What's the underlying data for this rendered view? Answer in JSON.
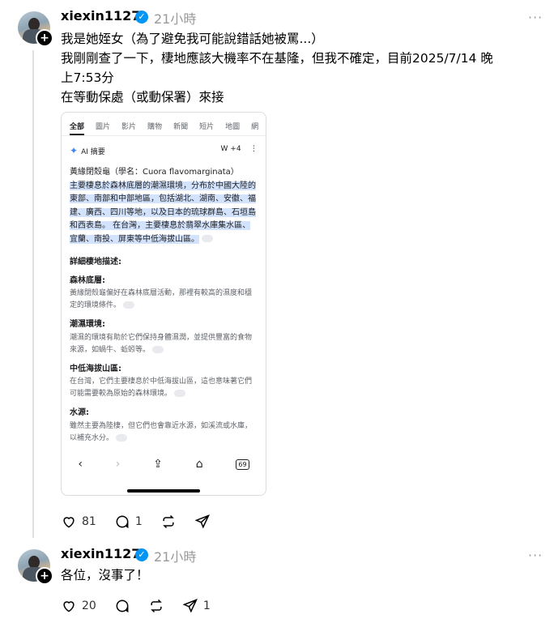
{
  "post1": {
    "username": "xiexin1127",
    "time": "21小時",
    "more": "···",
    "lines": [
      "我是她姪女（為了避免我可能說錯話她被罵...）",
      "我剛剛查了一下，棲地應該大機率不在基隆，但我不確定，目前2025/7/14 晚",
      "上7:53分",
      "在等動保處（或動保署）來接"
    ],
    "likes": "81",
    "comments": "1"
  },
  "screenshot": {
    "tabs": [
      "全部",
      "圖片",
      "影片",
      "購物",
      "新聞",
      "短片",
      "地圖",
      "網"
    ],
    "ai_label": "AI 摘要",
    "ai_sources": "W +4",
    "ai_menu": "⋮",
    "intro": "黃緣閉殼龜（學名：Cuora flavomarginata）",
    "highlight": "主要棲息於森林底層的潮濕環境，分布於中國大陸的東部、南部和中部地區，包括湖北、湖南、安徽、福建、廣西、四川等地，以及日本的琉球群島、石垣島和西表島。 在台灣，主要棲息於翡翠水庫集水區、宜蘭、南投、屏東等中低海拔山區。",
    "detail_title": "詳細棲地描述:",
    "sections": [
      {
        "title": "森林底層:",
        "text": "黃緣閉殼龜偏好在森林底層活動，那裡有較高的濕度和穩定的環境條件。"
      },
      {
        "title": "潮濕環境:",
        "text": "潮濕的環境有助於它們保持身體濕潤，並提供豐富的食物來源，如蝸牛、蚯蚓等。"
      },
      {
        "title": "中低海拔山區:",
        "text": "在台灣，它們主要棲息於中低海拔山區，這也意味著它們可能需要較為原始的森林環境。"
      },
      {
        "title": "水源:",
        "text": "雖然主要為陸棲，但它們也會靠近水源，如溪流或水庫，以補充水分。"
      }
    ],
    "tab_count": "69"
  },
  "post2": {
    "username": "xiexin1127",
    "time": "21小時",
    "more": "···",
    "text": "各位，沒事了！",
    "likes": "20",
    "shares": "1"
  },
  "icons": {
    "like": "heart-icon",
    "comment": "comment-icon",
    "repost": "repost-icon",
    "share": "send-icon"
  }
}
